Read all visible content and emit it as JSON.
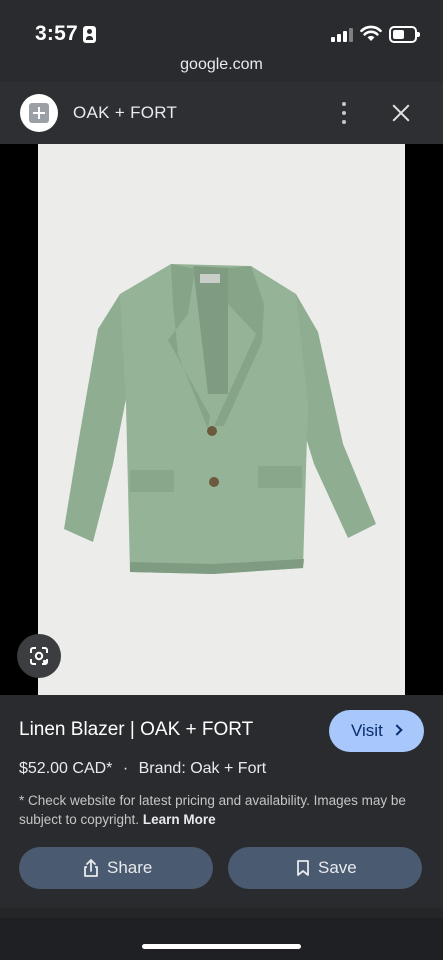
{
  "status_bar": {
    "time": "3:57",
    "icons": [
      "id-card-icon",
      "cellular-signal-icon",
      "wifi-icon",
      "battery-icon"
    ]
  },
  "browser": {
    "url": "google.com"
  },
  "header": {
    "site_name": "OAK + FORT",
    "icons": [
      "site-logo-icon",
      "more-vert-icon",
      "close-icon"
    ]
  },
  "product": {
    "title": "Linen Blazer | OAK + FORT",
    "price": "$52.00 CAD*",
    "separator": "·",
    "brand": "Brand: Oak + Fort",
    "disclaimer": "* Check website for latest pricing and availability. Images may be subject to copyright.",
    "learn_more": "Learn More",
    "image_alt": "green linen blazer"
  },
  "buttons": {
    "visit": "Visit",
    "share": "Share",
    "save": "Save"
  },
  "colors": {
    "accent": "#a8c7fa",
    "action_button": "#4a5a70",
    "background": "#2a2b2e",
    "blazer": "#95b397"
  }
}
